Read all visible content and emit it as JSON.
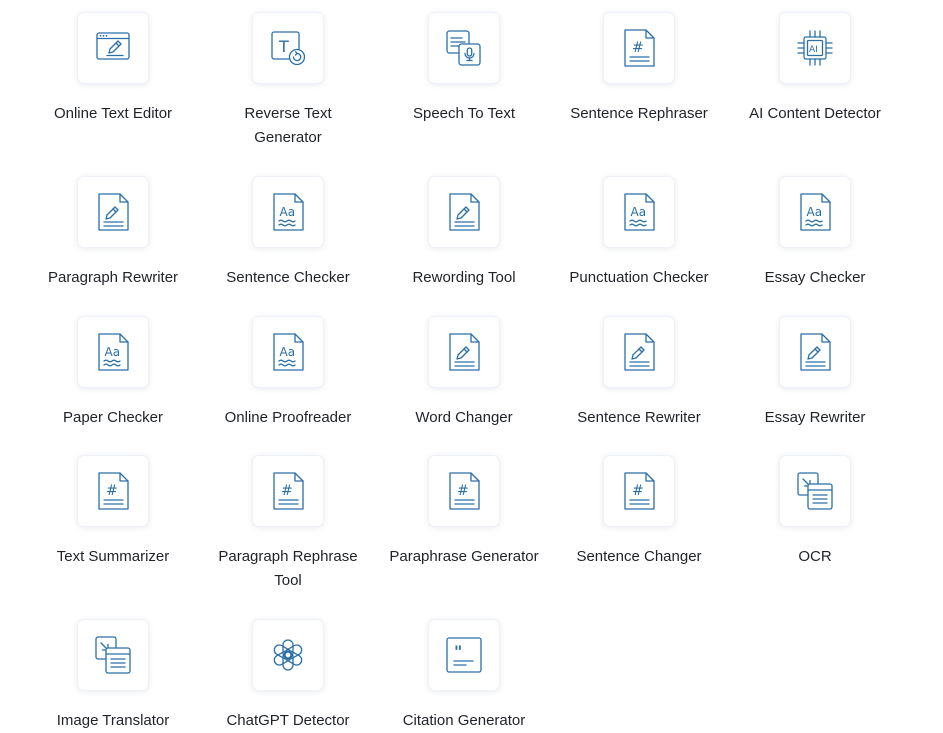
{
  "colors": {
    "icon": "#2a6fa8",
    "text": "#1f2328",
    "tile_border": "#eef1f6"
  },
  "tools": [
    {
      "label": "Online Text Editor",
      "icon": "browser-pencil-icon"
    },
    {
      "label": "Reverse Text Generator",
      "icon": "text-reverse-icon"
    },
    {
      "label": "Speech To Text",
      "icon": "speech-to-text-icon"
    },
    {
      "label": "Sentence Rephraser",
      "icon": "hash-document-icon"
    },
    {
      "label": "AI Content Detector",
      "icon": "ai-chip-icon"
    },
    {
      "label": "Paragraph Rewriter",
      "icon": "pencil-document-icon"
    },
    {
      "label": "Sentence Checker",
      "icon": "aa-document-icon"
    },
    {
      "label": "Rewording Tool",
      "icon": "pencil-document-icon"
    },
    {
      "label": "Punctuation Checker",
      "icon": "aa-document-icon"
    },
    {
      "label": "Essay Checker",
      "icon": "aa-document-icon"
    },
    {
      "label": "Paper Checker",
      "icon": "aa-document-icon"
    },
    {
      "label": "Online Proofreader",
      "icon": "aa-document-icon"
    },
    {
      "label": "Word Changer",
      "icon": "pencil-document-icon"
    },
    {
      "label": "Sentence Rewriter",
      "icon": "pencil-document-icon"
    },
    {
      "label": "Essay Rewriter",
      "icon": "pencil-document-icon"
    },
    {
      "label": "Text Summarizer",
      "icon": "hash-document-icon"
    },
    {
      "label": "Paragraph Rephrase Tool",
      "icon": "hash-document-icon"
    },
    {
      "label": "Paraphrase Generator",
      "icon": "hash-document-icon"
    },
    {
      "label": "Sentence Changer",
      "icon": "hash-document-icon"
    },
    {
      "label": "OCR",
      "icon": "image-to-text-icon"
    },
    {
      "label": "Image Translator",
      "icon": "image-to-text-icon"
    },
    {
      "label": "ChatGPT Detector",
      "icon": "chatgpt-logo-icon"
    },
    {
      "label": "Citation Generator",
      "icon": "quote-card-icon"
    }
  ]
}
